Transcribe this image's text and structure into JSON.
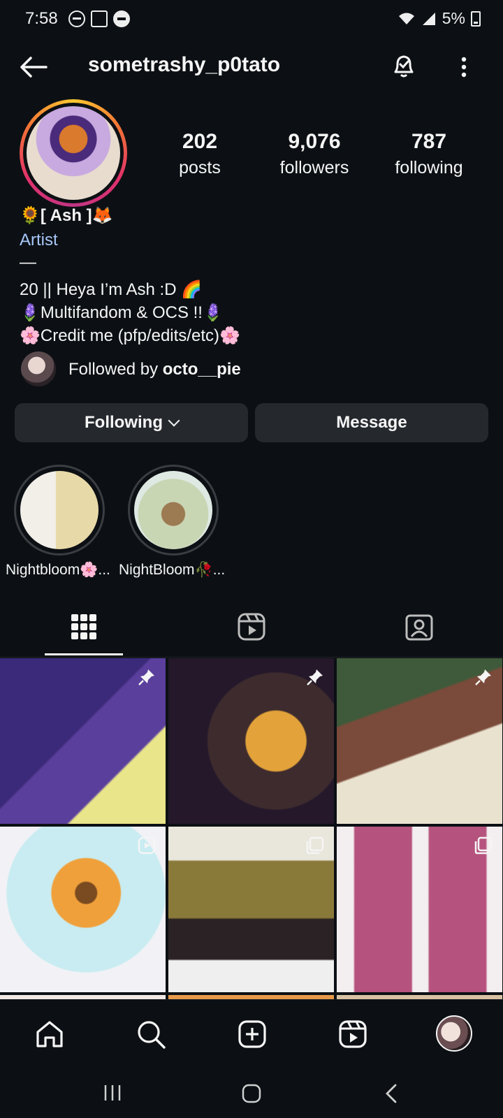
{
  "status_bar": {
    "time": "7:58",
    "battery": "5%",
    "icons": [
      "do-not-disturb-icon",
      "image-icon",
      "minus-circle-icon",
      "wifi-icon",
      "signal-icon",
      "battery-icon"
    ]
  },
  "header": {
    "username": "sometrashy_p0tato",
    "icons": [
      "back-arrow-icon",
      "bell-check-icon",
      "more-vertical-icon"
    ]
  },
  "profile": {
    "stats": [
      {
        "number": "202",
        "label": "posts"
      },
      {
        "number": "9,076",
        "label": "followers"
      },
      {
        "number": "787",
        "label": "following"
      }
    ],
    "display_name": "🌻[ Ash ]🦊",
    "category": "Artist",
    "bio": [
      "—",
      "20 || Heya I’m Ash :D 🌈",
      "🪻Multifandom & OCS !!🪻",
      "🌸Credit me (pfp/edits/etc)🌸"
    ],
    "followed_by_prefix": "Followed by ",
    "followed_by_user": "octo__pie"
  },
  "actions": {
    "following_label": "Following",
    "message_label": "Message"
  },
  "highlights": [
    {
      "label": "Nightbloom🌸..."
    },
    {
      "label": "NightBloom🥀..."
    }
  ],
  "tabs": [
    "grid-icon",
    "reels-icon",
    "tagged-icon"
  ],
  "grid": {
    "tiles": [
      {
        "type": "pinned"
      },
      {
        "type": "pinned"
      },
      {
        "type": "pinned"
      },
      {
        "type": "reel"
      },
      {
        "type": "carousel"
      },
      {
        "type": "carousel"
      }
    ]
  },
  "bottom_nav": [
    "home-icon",
    "search-icon",
    "create-icon",
    "reels-icon",
    "profile-avatar"
  ],
  "colors": {
    "background": "#0c1014",
    "button": "#25292e",
    "link": "#a8c7fa"
  }
}
